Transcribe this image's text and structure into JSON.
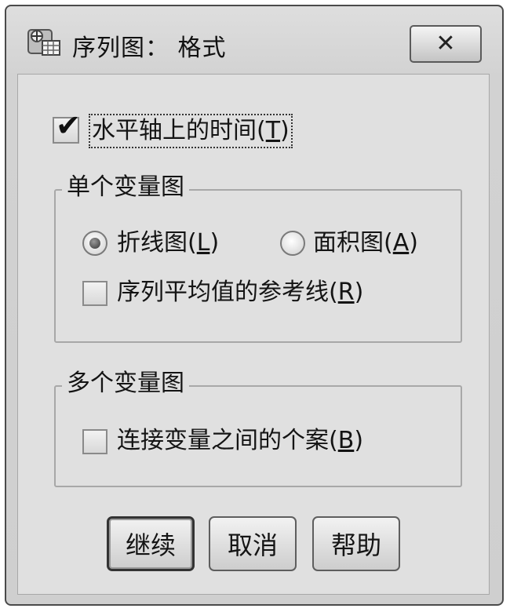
{
  "window": {
    "title": "序列图： 格式",
    "close_glyph": "✕"
  },
  "options": {
    "time_on_horizontal_axis": {
      "checked": true,
      "label_main": "水平轴上的时间(",
      "mnemonic": "T",
      "label_end": ")"
    }
  },
  "single_variable_chart": {
    "title": "单个变量图",
    "line_chart": {
      "selected": true,
      "label_main": "折线图(",
      "mnemonic": "L",
      "label_end": ")"
    },
    "area_chart": {
      "selected": false,
      "label_main": "面积图(",
      "mnemonic": "A",
      "label_end": ")"
    },
    "series_mean_reference_line": {
      "checked": false,
      "label_main": "序列平均值的参考线(",
      "mnemonic": "R",
      "label_end": ")"
    }
  },
  "multi_variable_chart": {
    "title": "多个变量图",
    "connect_cases_between_variables": {
      "checked": false,
      "label_main": "连接变量之间的个案(",
      "mnemonic": "B",
      "label_end": ")"
    }
  },
  "buttons": {
    "continue": "继续",
    "cancel": "取消",
    "help": "帮助"
  },
  "icons": {
    "app": "chart-grid-icon",
    "close": "close-icon",
    "check": "checkmark-icon"
  },
  "colors": {
    "dialog_background": "#e0e0e0",
    "border": "#a8a8a8"
  }
}
